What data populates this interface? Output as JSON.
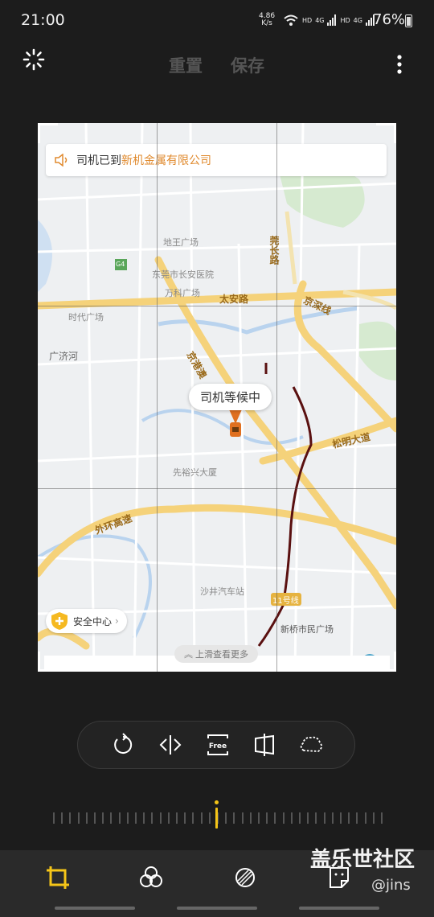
{
  "status_bar": {
    "time": "21:00",
    "net_speed": "4.86",
    "net_unit": "K/s",
    "sim1_label": "HD",
    "sim2_label": "HD",
    "sig1": "4G",
    "sig2": "4G",
    "battery": "76%",
    "battery_level": 0.76
  },
  "toolbar": {
    "reset_label": "重置",
    "save_label": "保存"
  },
  "map": {
    "notice_prefix": "司机已到",
    "notice_highlight": "新机金属有限公司",
    "labels": {
      "dwg": "地王广场",
      "hospital": "东莞市长安医院",
      "wanke": "万科广场",
      "shidai": "时代广场",
      "guangji": "广济河",
      "xianyu": "先裕兴大厦",
      "shajing": "沙井汽车站",
      "xinqiao": "新桥市民广场",
      "g4": "G4",
      "line11": "11号线"
    },
    "roads": {
      "taian": "太安路",
      "jingshen": "京深线",
      "guanchang": "莞长路",
      "jinggang": "京港澳",
      "songming": "松明大道",
      "waihuan": "外环高速"
    },
    "wait_bubble": "司机等候中",
    "safety_center": "安全中心",
    "swipe_hint": "上滑查看更多"
  },
  "tools": [
    "rotate-icon",
    "flip-icon",
    "free-ratio-icon",
    "perspective-icon",
    "lasso-icon"
  ],
  "tool_free_text": "Free",
  "nav": [
    "crop-icon",
    "filter-icon",
    "adjust-icon",
    "sticker-icon"
  ],
  "watermark": {
    "text": "盖乐世社区",
    "user": "@jins"
  },
  "colors": {
    "accent": "#f5c518",
    "route": "#5a1010",
    "major_road": "#f5d27a"
  }
}
